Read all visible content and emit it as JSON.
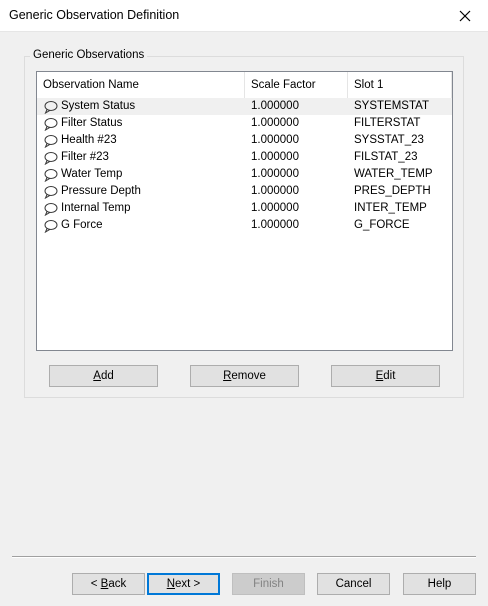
{
  "window": {
    "title": "Generic Observation Definition",
    "close_icon": "close-icon"
  },
  "group": {
    "legend": "Generic Observations"
  },
  "list": {
    "columns": [
      "Observation Name",
      "Scale Factor",
      "Slot 1"
    ],
    "row_icon": "observation-icon",
    "selected_row_index": 0,
    "rows": [
      {
        "name": "System Status",
        "scale": "1.000000",
        "slot": "SYSTEMSTAT"
      },
      {
        "name": "Filter Status",
        "scale": "1.000000",
        "slot": "FILTERSTAT"
      },
      {
        "name": "Health #23",
        "scale": "1.000000",
        "slot": "SYSSTAT_23"
      },
      {
        "name": "Filter #23",
        "scale": "1.000000",
        "slot": "FILSTAT_23"
      },
      {
        "name": "Water Temp",
        "scale": "1.000000",
        "slot": "WATER_TEMP"
      },
      {
        "name": "Pressure Depth",
        "scale": "1.000000",
        "slot": "PRES_DEPTH"
      },
      {
        "name": "Internal Temp",
        "scale": "1.000000",
        "slot": "INTER_TEMP"
      },
      {
        "name": "G Force",
        "scale": "1.000000",
        "slot": "G_FORCE"
      }
    ]
  },
  "actions": {
    "add": {
      "mnemonic": "A",
      "rest": "dd"
    },
    "remove": {
      "mnemonic": "R",
      "rest": "emove"
    },
    "edit": {
      "mnemonic": "E",
      "rest": "dit"
    }
  },
  "wizard": {
    "back": {
      "prefix": "< ",
      "mnemonic": "B",
      "rest": "ack"
    },
    "next": {
      "mnemonic": "N",
      "rest": "ext >"
    },
    "finish": "Finish",
    "finish_enabled": false,
    "cancel": "Cancel",
    "help": "Help"
  },
  "colors": {
    "default_button_border": "#0078d7",
    "disabled_text": "#838383"
  }
}
